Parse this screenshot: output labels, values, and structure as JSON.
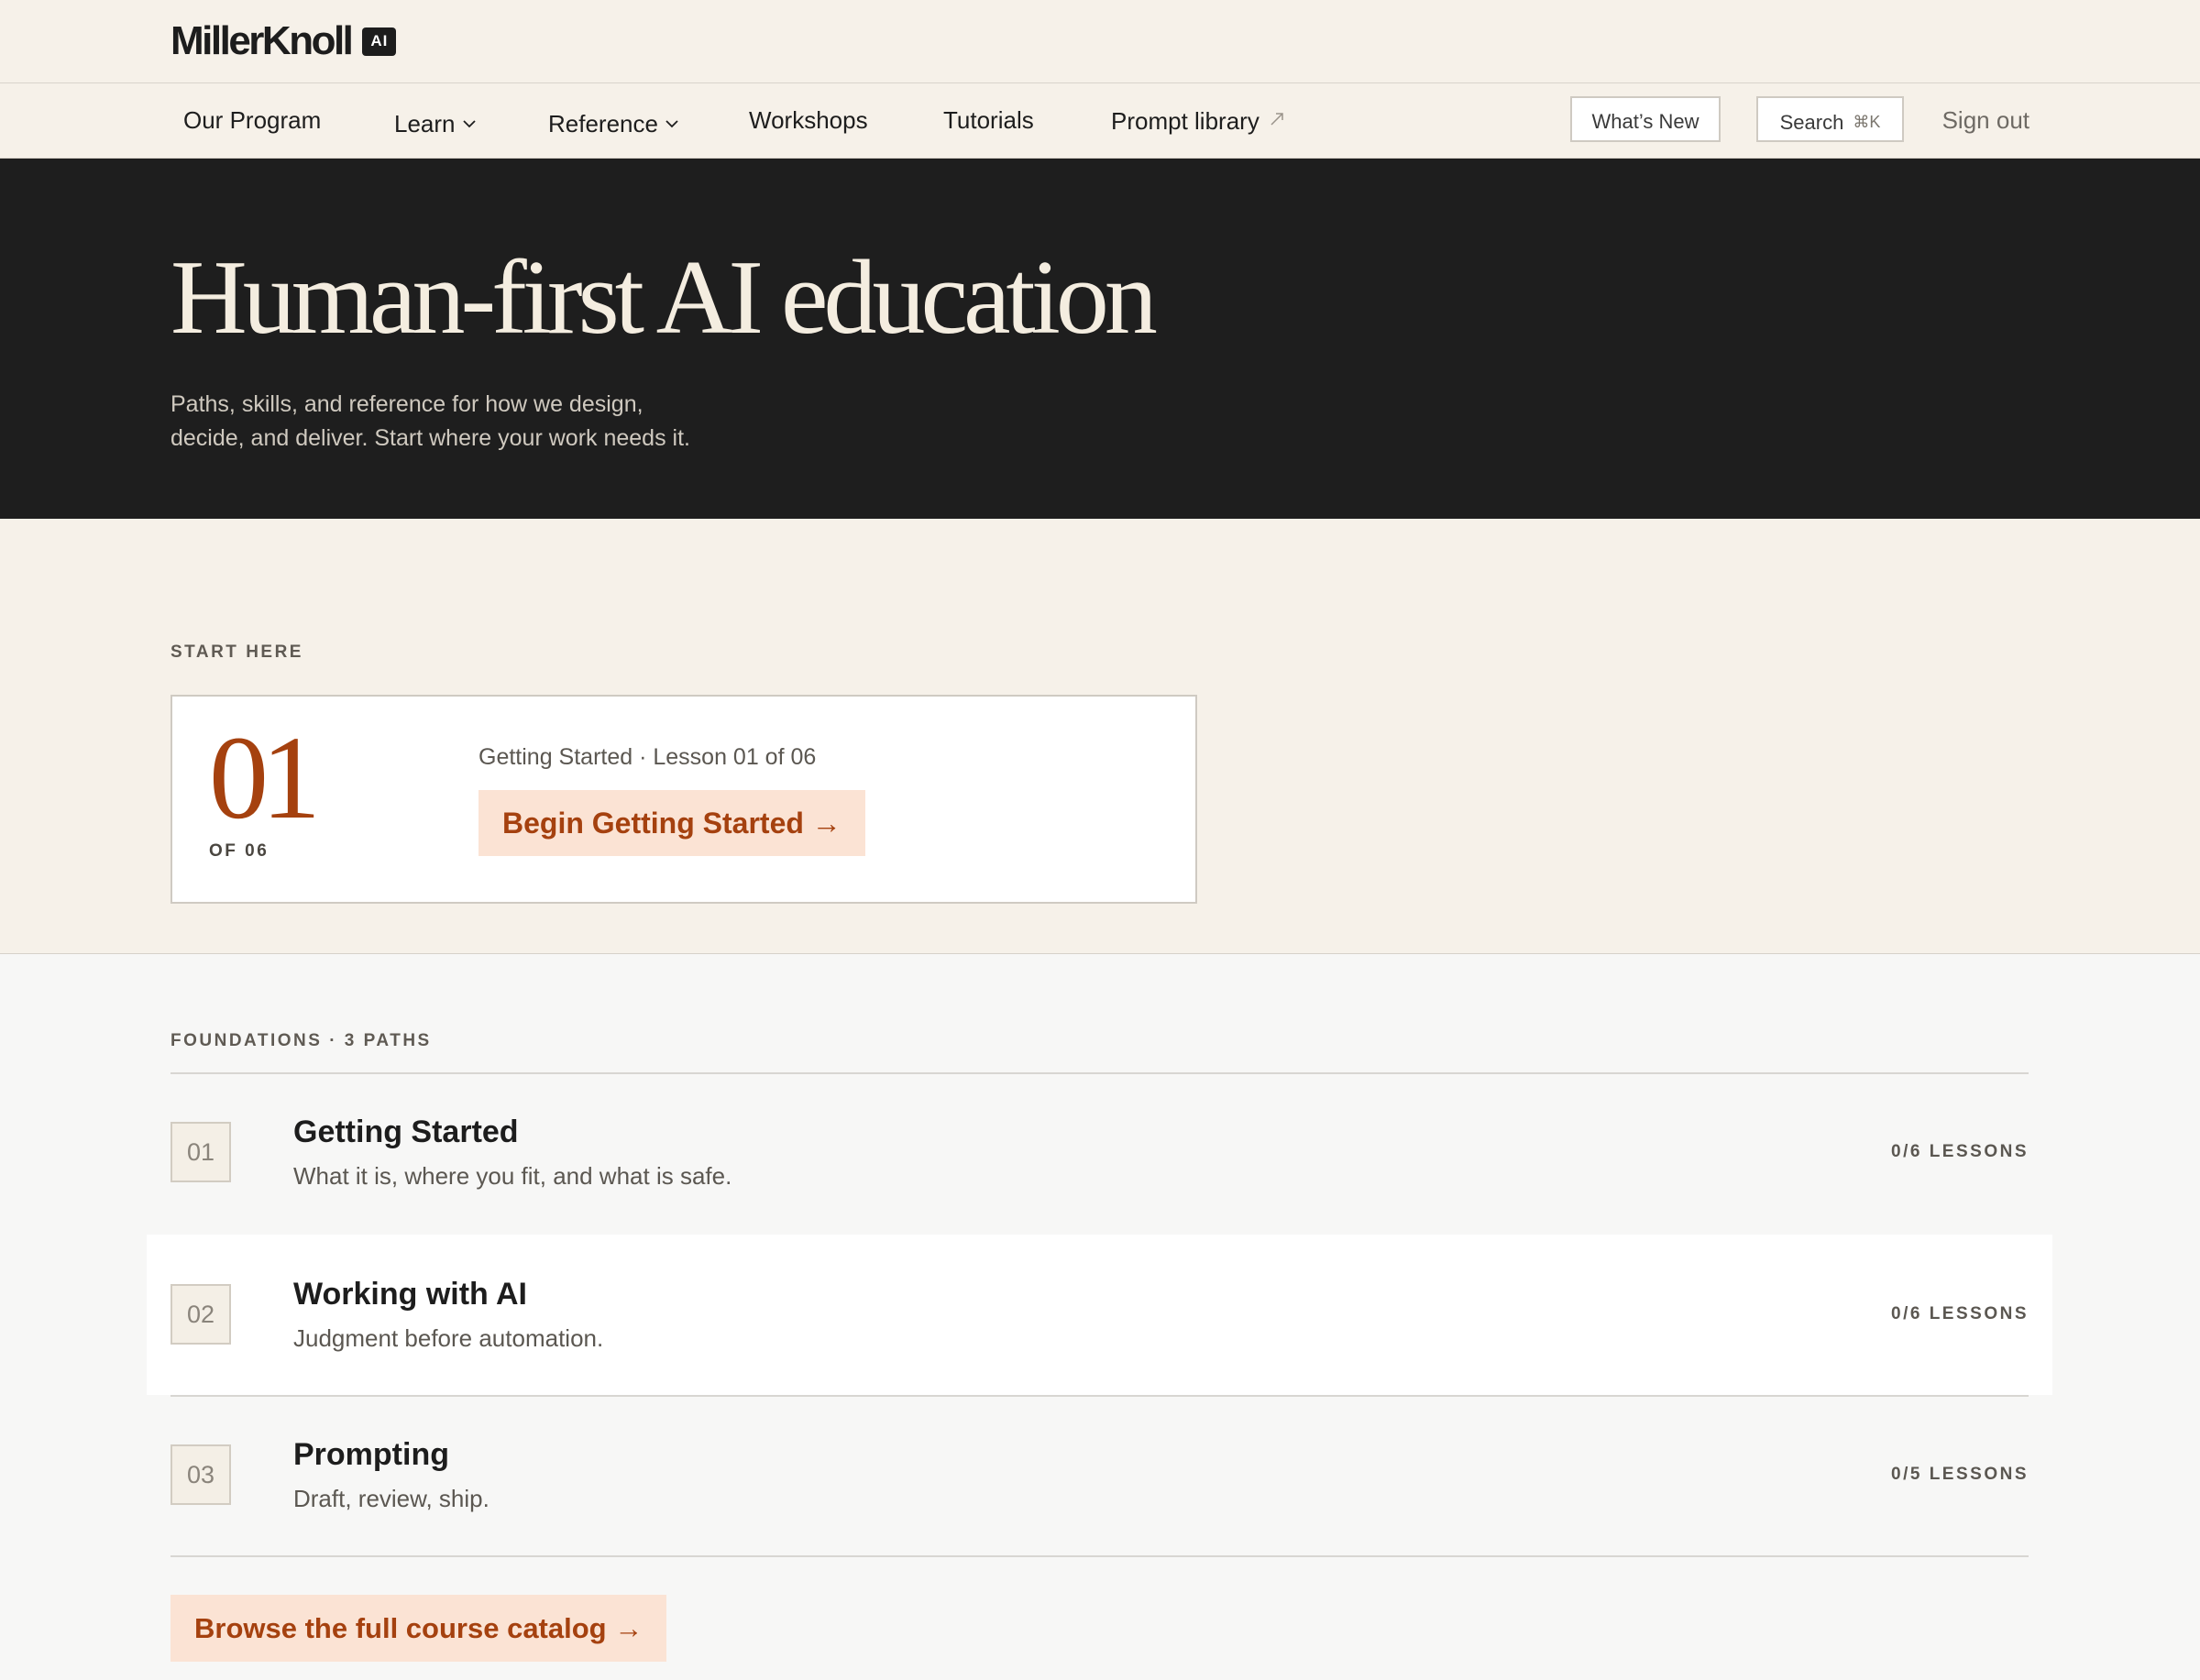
{
  "brand": {
    "wordmark": "MillerKnoll",
    "badge": "AI"
  },
  "nav": {
    "items": [
      {
        "label": "Our Program"
      },
      {
        "label": "Learn",
        "has_menu": true
      },
      {
        "label": "Reference",
        "has_menu": true
      },
      {
        "label": "Workshops"
      },
      {
        "label": "Tutorials"
      },
      {
        "label": "Prompt library",
        "external": true
      }
    ],
    "whats_new": "What’s New",
    "search": {
      "label": "Search",
      "shortcut": "⌘K"
    },
    "sign_out": "Sign out"
  },
  "hero": {
    "title": "Human-first AI education",
    "subtitle_line1": "Paths, skills, and reference for how we design,",
    "subtitle_line2": "decide, and deliver. Start where your work needs it."
  },
  "start": {
    "eyebrow": "START HERE",
    "number": "01",
    "of_total": "OF 06",
    "meta": "Getting Started · Lesson 01 of 06",
    "cta": "Begin Getting Started →"
  },
  "foundations": {
    "eyebrow": "FOUNDATIONS · 3 PATHS",
    "paths": [
      {
        "num": "01",
        "title": "Getting Started",
        "desc": "What it is, where you fit, and what is safe.",
        "count": "0/6 LESSONS"
      },
      {
        "num": "02",
        "title": "Working with AI",
        "desc": "Judgment before automation.",
        "count": "0/6 LESSONS"
      },
      {
        "num": "03",
        "title": "Prompting",
        "desc": "Draft, review, ship.",
        "count": "0/5 LESSONS"
      }
    ],
    "browse": "Browse the full course catalog →"
  },
  "colors": {
    "page_bg": "#f6f1e9",
    "hero_bg": "#1e1e1e",
    "accent": "#a5410f",
    "cta_bg": "#fbe3d4"
  }
}
